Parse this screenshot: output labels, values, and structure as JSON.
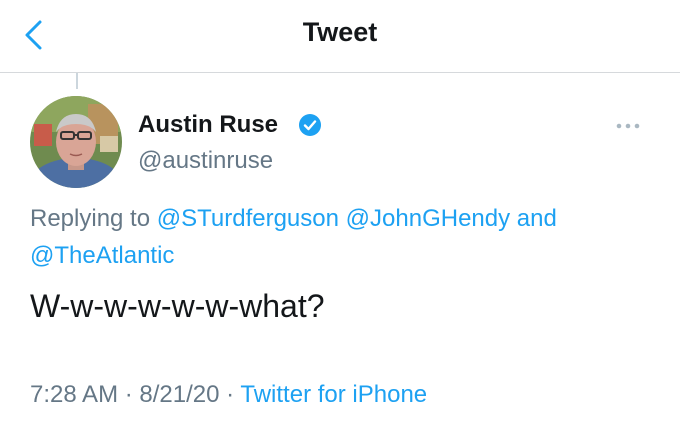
{
  "header": {
    "title": "Tweet",
    "back_icon": "chevron-left-icon"
  },
  "tweet": {
    "author_name": "Austin Ruse",
    "verified": true,
    "handle": "@austinruse",
    "more_icon": "ellipsis-icon",
    "replying_prefix": "Replying to",
    "mentions": [
      "@STurdferguson",
      "@JohnGHendy",
      "@TheAtlantic"
    ],
    "mentions_joiner": "and",
    "text": "W-w-w-w-w-w-what?",
    "time": "7:28 AM",
    "date": "8/21/20",
    "separator": "·",
    "source": "Twitter for iPhone"
  },
  "colors": {
    "accent": "#1da1f2",
    "text": "#14171a",
    "secondary": "#657786",
    "divider": "#d6d9dc"
  }
}
